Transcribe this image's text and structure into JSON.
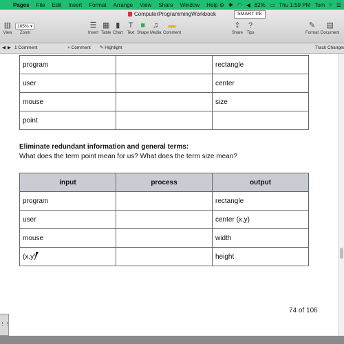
{
  "menubar": {
    "app": "Pages",
    "items": [
      "File",
      "Edit",
      "Insert",
      "Format",
      "Arrange",
      "View",
      "Share",
      "Window",
      "Help"
    ],
    "battery": "82%",
    "clock": "Thu 1:59 PM",
    "user": "Tom"
  },
  "window": {
    "title": "ComputerProgrammingWorkbook",
    "smart_ink": "SMART Ink"
  },
  "toolbar": {
    "view": "View",
    "zoom_value": "165%",
    "zoom": "Zoom",
    "insert": "Insert",
    "table": "Table",
    "chart": "Chart",
    "text": "Text",
    "shape": "Shape",
    "media": "Media",
    "comment": "Comment",
    "share": "Share",
    "tips": "Tips",
    "format": "Format",
    "document": "Document"
  },
  "subbar": {
    "comments_count": "1 Comment",
    "add_comment": "Comment",
    "highlight": "Highlight",
    "track_changes": "Track Changes"
  },
  "table1": {
    "rows": [
      [
        "program",
        "",
        "rectangle"
      ],
      [
        "user",
        "",
        "center"
      ],
      [
        "mouse",
        "",
        "size"
      ],
      [
        "point",
        "",
        ""
      ]
    ]
  },
  "section": {
    "heading": "Eliminate redundant information and general terms:",
    "question": "What does the term point mean for us? What does the term size mean?"
  },
  "table2": {
    "headers": [
      "input",
      "process",
      "output"
    ],
    "rows": [
      [
        "program",
        "",
        "rectangle"
      ],
      [
        "user",
        "",
        "center (x,y)"
      ],
      [
        "mouse",
        "",
        "width"
      ],
      [
        "(x,y)",
        "",
        "height"
      ]
    ]
  },
  "page_number": "74 of 106"
}
